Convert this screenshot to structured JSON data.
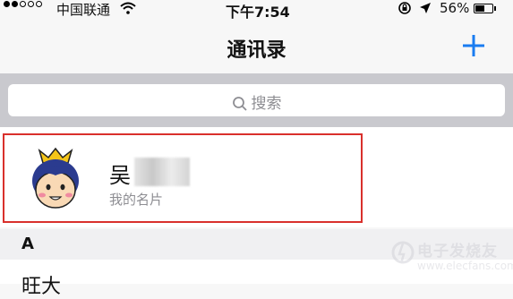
{
  "status_bar": {
    "signal_dots": [
      true,
      true,
      false,
      false,
      false
    ],
    "carrier": "中国联通",
    "time": "下午7:54",
    "battery_percent": "56%",
    "battery_level": 0.56
  },
  "nav": {
    "title": "通讯录",
    "add_icon": "plus-icon",
    "accent_color": "#1a7cf0"
  },
  "search": {
    "placeholder": "搜索"
  },
  "my_card": {
    "name": "吴",
    "subtitle": "我的名片",
    "highlight_color": "#d9302c"
  },
  "sections": [
    {
      "letter": "A",
      "first_entry": "旺大"
    }
  ],
  "watermark": {
    "text": "电子发烧友",
    "url": "www.elecfans.com"
  }
}
